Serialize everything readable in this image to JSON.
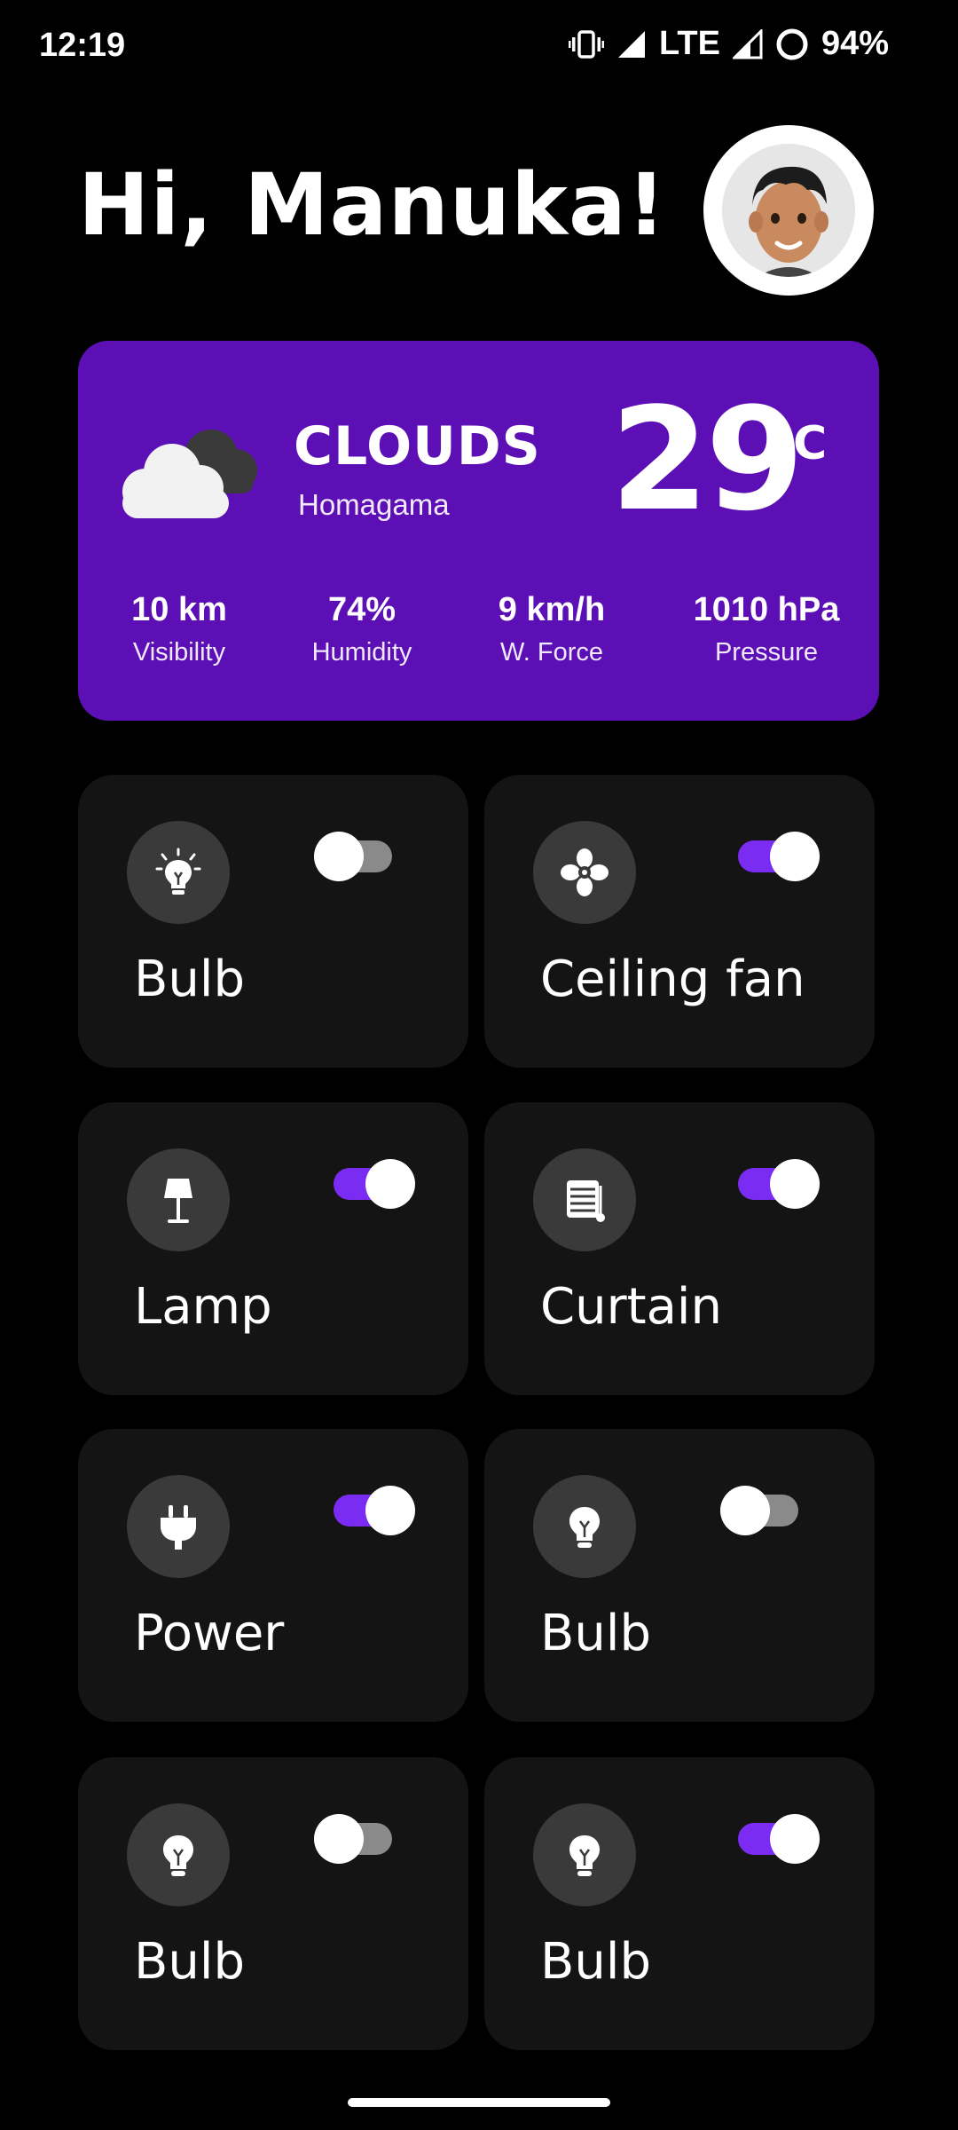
{
  "status": {
    "time": "12:19",
    "network": "LTE",
    "battery": "94%"
  },
  "greeting": "Hi, Manuka!",
  "weather": {
    "condition": "CLOUDS",
    "location": "Homagama",
    "temperature": "29",
    "unit": "°C",
    "stats": [
      {
        "value": "10 km",
        "label": "Visibility"
      },
      {
        "value": "74%",
        "label": "Humidity"
      },
      {
        "value": "9 km/h",
        "label": "W. Force"
      },
      {
        "value": "1010 hPa",
        "label": "Pressure"
      }
    ],
    "card_color": "#5b0fb5"
  },
  "devices": [
    {
      "label": "Bulb",
      "icon": "bulb-glow-icon",
      "on": false
    },
    {
      "label": "Ceiling fan",
      "icon": "fan-icon",
      "on": true
    },
    {
      "label": "Lamp",
      "icon": "lamp-icon",
      "on": true
    },
    {
      "label": "Curtain",
      "icon": "curtain-icon",
      "on": true
    },
    {
      "label": "Power",
      "icon": "plug-icon",
      "on": true
    },
    {
      "label": "Bulb",
      "icon": "bulb-icon",
      "on": false
    },
    {
      "label": "Bulb",
      "icon": "bulb-icon",
      "on": false
    },
    {
      "label": "Bulb",
      "icon": "bulb-icon",
      "on": true
    }
  ],
  "accent_color": "#7b2cf2"
}
